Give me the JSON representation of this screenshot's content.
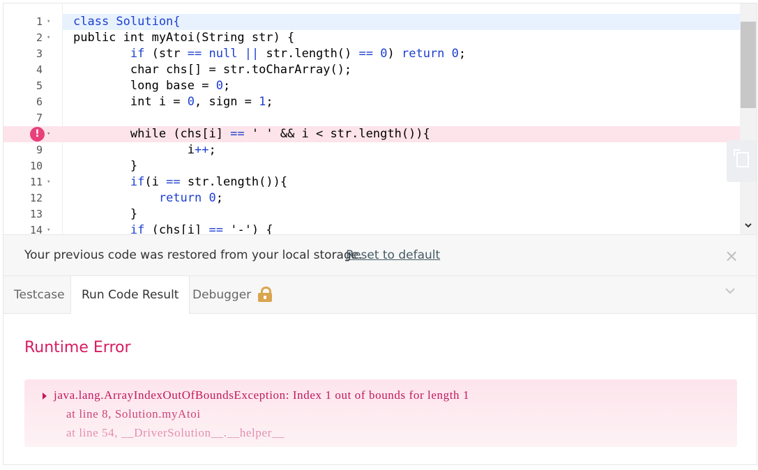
{
  "editor": {
    "lines": [
      {
        "n": "1",
        "fold": "▾",
        "text": "class Solution{"
      },
      {
        "n": "2",
        "fold": "▾",
        "text": "public int myAtoi(String str) {"
      },
      {
        "n": "3",
        "fold": "",
        "text": "        if (str == null || str.length() == 0) return 0;"
      },
      {
        "n": "4",
        "fold": "",
        "text": "        char chs[] = str.toCharArray();"
      },
      {
        "n": "5",
        "fold": "",
        "text": "        long base = 0;"
      },
      {
        "n": "6",
        "fold": "",
        "text": "        int i = 0, sign = 1;"
      },
      {
        "n": "7",
        "fold": "",
        "text": ""
      },
      {
        "n": "8",
        "fold": "▾",
        "text": "        while (chs[i] == ' ' && i < str.length()){"
      },
      {
        "n": "9",
        "fold": "",
        "text": "                i++;"
      },
      {
        "n": "10",
        "fold": "",
        "text": "        }"
      },
      {
        "n": "11",
        "fold": "▾",
        "text": "        if(i == str.length()){"
      },
      {
        "n": "12",
        "fold": "",
        "text": "            return 0;"
      },
      {
        "n": "13",
        "fold": "",
        "text": "        }"
      },
      {
        "n": "14",
        "fold": "▾",
        "text": "        if (chs[i] == '-') {"
      }
    ],
    "error_marker": "!",
    "active_line": 1,
    "error_line": 8
  },
  "notice": {
    "text": "Your previous code was restored from your local storage.",
    "link": "Reset to default",
    "close": "×"
  },
  "tabs": {
    "testcase": "Testcase",
    "run_result": "Run Code Result",
    "debugger": "Debugger"
  },
  "result": {
    "title": "Runtime Error",
    "lines": [
      "java.lang.ArrayIndexOutOfBoundsException: Index 1 out of bounds for length 1",
      "at line 8, Solution.myAtoi",
      "at line 54, __DriverSolution__.__helper__"
    ]
  },
  "colors": {
    "error_accent": "#d81b60",
    "keyword": "#1c3fd0",
    "active_line_bg": "#e8f2ff",
    "error_line_bg": "#fce4ea",
    "lock": "#d9a54e"
  },
  "icons": [
    "error-marker-icon",
    "fold-arrow-icon",
    "copy-icon",
    "close-icon",
    "lock-icon",
    "chevron-down-icon",
    "expand-triangle-icon"
  ]
}
